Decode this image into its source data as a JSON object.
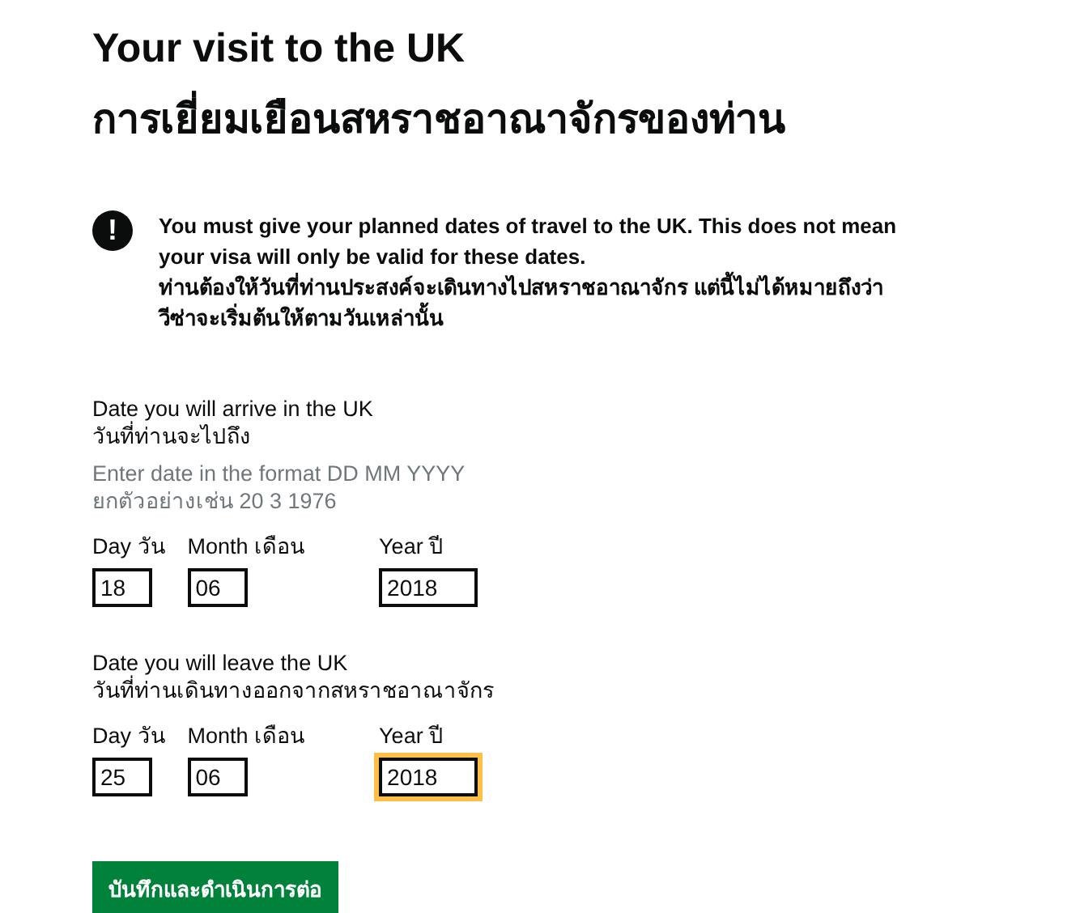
{
  "headings": [
    "Your visit to the UK",
    "การเยี่ยมเยือนสหราชอาณาจักรของท่าน"
  ],
  "warning": {
    "icon": "!",
    "lines": [
      "You must give your planned dates of travel to the UK. This does not mean your visa will only be valid for these dates.",
      "ท่านต้องให้วันที่ท่านประสงค์จะเดินทางไปสหราชอาณาจักร แต่นี้ไม่ได้หมายถึงว่าวีซ่าจะเริ่มต้นให้ตามวันเหล่านั้น"
    ]
  },
  "date_groups": [
    {
      "legend": [
        "Date you will arrive in the UK",
        "วันที่ท่านจะไปถึง"
      ],
      "hint": [
        "Enter date in the format DD MM YYYY",
        "ยกตัวอย่างเช่น 20 3 1976"
      ],
      "fields": [
        {
          "kind": "day",
          "label": "Day วัน",
          "value": "18",
          "focused": false
        },
        {
          "kind": "month",
          "label": "Month เดือน",
          "value": "06",
          "focused": false
        },
        {
          "kind": "year",
          "label": "Year ปี",
          "value": "2018",
          "focused": false
        }
      ]
    },
    {
      "legend": [
        "Date you will leave the UK",
        "วันที่ท่านเดินทางออกจากสหราชอาณาจักร"
      ],
      "fields": [
        {
          "kind": "day",
          "label": "Day วัน",
          "value": "25",
          "focused": false
        },
        {
          "kind": "month",
          "label": "Month เดือน",
          "value": "06",
          "focused": false
        },
        {
          "kind": "year",
          "label": "Year ปี",
          "value": "2018",
          "focused": true
        }
      ]
    }
  ],
  "button": "บันทึกและดำเนินการต่อ"
}
